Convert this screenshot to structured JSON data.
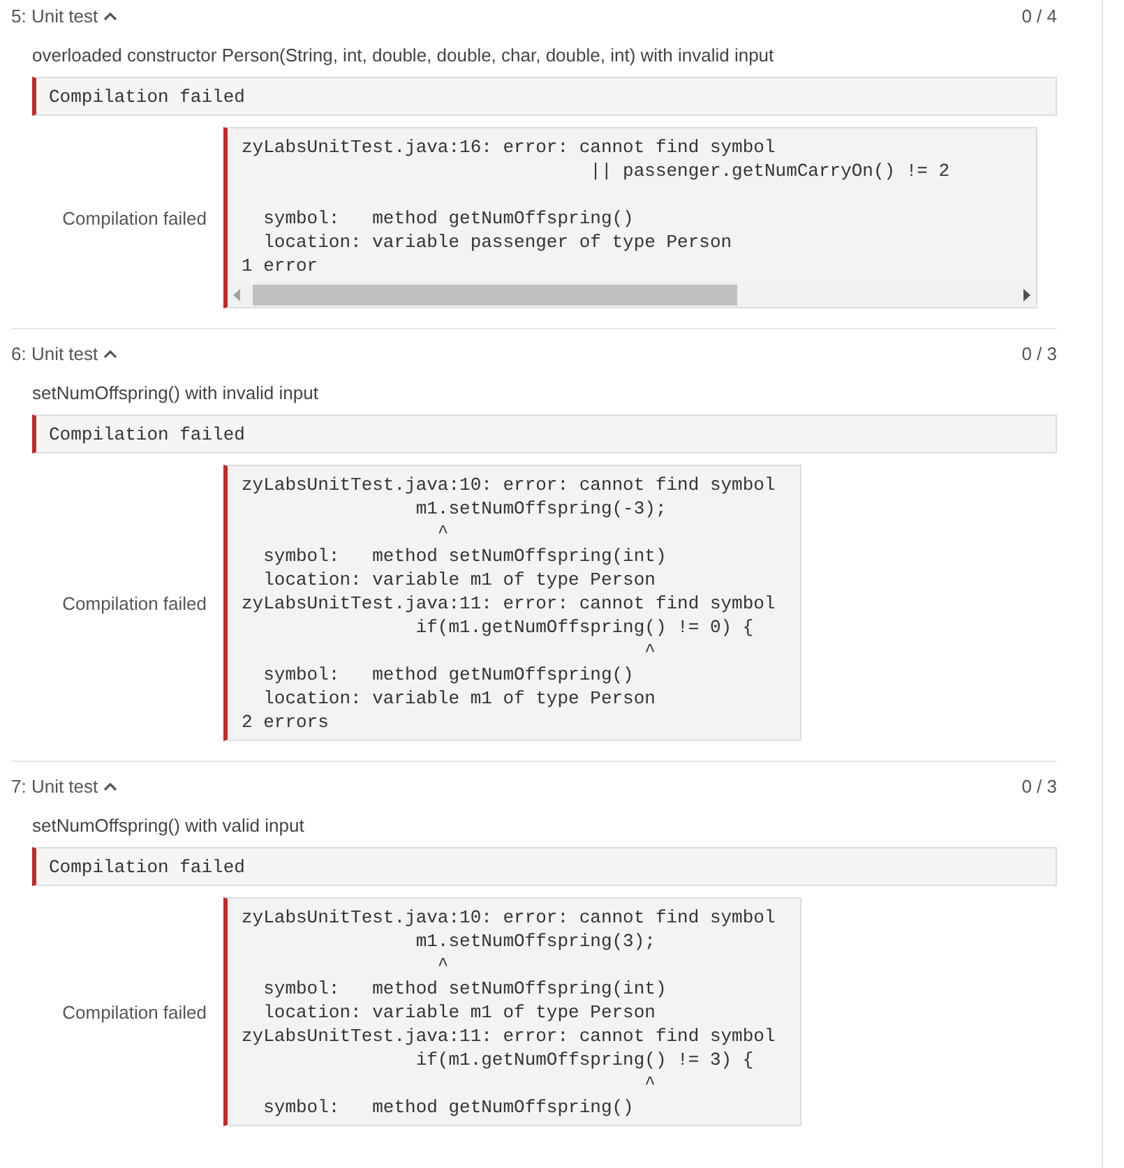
{
  "tests": [
    {
      "title": "5: Unit test",
      "expanded": true,
      "score": "0 / 4",
      "description": "overloaded constructor Person(String, int, double, double, char, double, int) with invalid input",
      "status": "Compilation failed",
      "output_label": "Compilation failed",
      "scrollable": true,
      "output": [
        "zyLabsUnitTest.java:16: error: cannot find symbol",
        "                                || passenger.getNumCarryOn() != 2\n",
        "  symbol:   method getNumOffspring()",
        "  location: variable passenger of type Person",
        "1 error"
      ]
    },
    {
      "title": "6: Unit test",
      "expanded": true,
      "score": "0 / 3",
      "description": "setNumOffspring() with invalid input",
      "status": "Compilation failed",
      "output_label": "Compilation failed",
      "scrollable": false,
      "output": [
        "zyLabsUnitTest.java:10: error: cannot find symbol",
        "                m1.setNumOffspring(-3);",
        "                  ^",
        "  symbol:   method setNumOffspring(int)",
        "  location: variable m1 of type Person",
        "zyLabsUnitTest.java:11: error: cannot find symbol",
        "                if(m1.getNumOffspring() != 0) {",
        "                                     ^",
        "  symbol:   method getNumOffspring()",
        "  location: variable m1 of type Person",
        "2 errors"
      ]
    },
    {
      "title": "7: Unit test",
      "expanded": true,
      "score": "0 / 3",
      "description": "setNumOffspring() with valid input",
      "status": "Compilation failed",
      "output_label": "Compilation failed",
      "scrollable": false,
      "output": [
        "zyLabsUnitTest.java:10: error: cannot find symbol",
        "                m1.setNumOffspring(3);",
        "                  ^",
        "  symbol:   method setNumOffspring(int)",
        "  location: variable m1 of type Person",
        "zyLabsUnitTest.java:11: error: cannot find symbol",
        "                if(m1.getNumOffspring() != 3) {",
        "                                     ^",
        "  symbol:   method getNumOffspring()"
      ]
    }
  ]
}
